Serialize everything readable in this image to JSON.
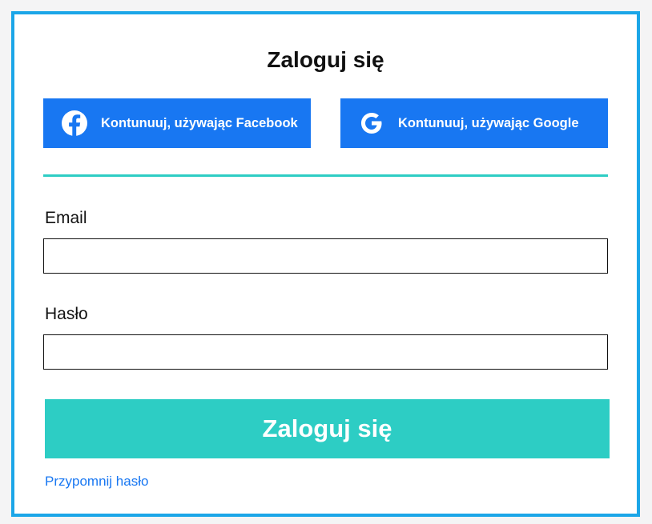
{
  "login": {
    "title": "Zaloguj się",
    "social": {
      "facebook_label": "Kontunuuj, używając Facebook",
      "google_label": "Kontunuuj, używając Google"
    },
    "email": {
      "label": "Email",
      "value": "",
      "placeholder": ""
    },
    "password": {
      "label": "Hasło",
      "value": "",
      "placeholder": ""
    },
    "submit_label": "Zaloguj się",
    "forgot_label": "Przypomnij hasło"
  },
  "icons": {
    "facebook": "facebook-icon",
    "google": "google-icon"
  },
  "colors": {
    "card_border": "#1ba6e8",
    "social_button": "#1877f2",
    "accent": "#2dcdc4",
    "link": "#1877f2",
    "background": "#f4f4f5"
  }
}
